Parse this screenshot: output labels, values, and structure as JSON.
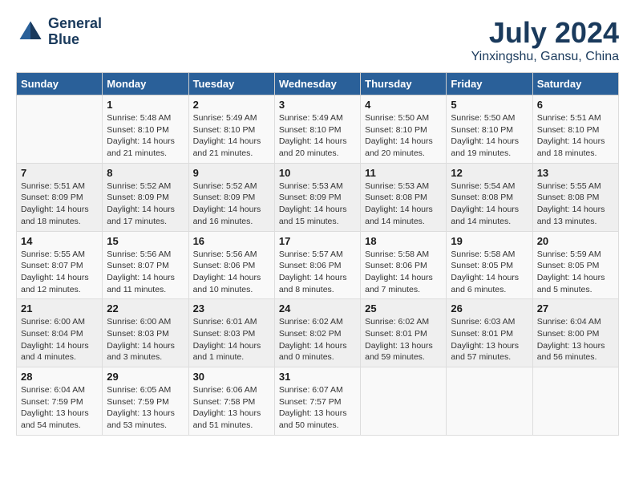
{
  "header": {
    "logo_line1": "General",
    "logo_line2": "Blue",
    "month": "July 2024",
    "location": "Yinxingshu, Gansu, China"
  },
  "weekdays": [
    "Sunday",
    "Monday",
    "Tuesday",
    "Wednesday",
    "Thursday",
    "Friday",
    "Saturday"
  ],
  "weeks": [
    [
      {
        "day": "",
        "info": ""
      },
      {
        "day": "1",
        "info": "Sunrise: 5:48 AM\nSunset: 8:10 PM\nDaylight: 14 hours\nand 21 minutes."
      },
      {
        "day": "2",
        "info": "Sunrise: 5:49 AM\nSunset: 8:10 PM\nDaylight: 14 hours\nand 21 minutes."
      },
      {
        "day": "3",
        "info": "Sunrise: 5:49 AM\nSunset: 8:10 PM\nDaylight: 14 hours\nand 20 minutes."
      },
      {
        "day": "4",
        "info": "Sunrise: 5:50 AM\nSunset: 8:10 PM\nDaylight: 14 hours\nand 20 minutes."
      },
      {
        "day": "5",
        "info": "Sunrise: 5:50 AM\nSunset: 8:10 PM\nDaylight: 14 hours\nand 19 minutes."
      },
      {
        "day": "6",
        "info": "Sunrise: 5:51 AM\nSunset: 8:10 PM\nDaylight: 14 hours\nand 18 minutes."
      }
    ],
    [
      {
        "day": "7",
        "info": "Sunrise: 5:51 AM\nSunset: 8:09 PM\nDaylight: 14 hours\nand 18 minutes."
      },
      {
        "day": "8",
        "info": "Sunrise: 5:52 AM\nSunset: 8:09 PM\nDaylight: 14 hours\nand 17 minutes."
      },
      {
        "day": "9",
        "info": "Sunrise: 5:52 AM\nSunset: 8:09 PM\nDaylight: 14 hours\nand 16 minutes."
      },
      {
        "day": "10",
        "info": "Sunrise: 5:53 AM\nSunset: 8:09 PM\nDaylight: 14 hours\nand 15 minutes."
      },
      {
        "day": "11",
        "info": "Sunrise: 5:53 AM\nSunset: 8:08 PM\nDaylight: 14 hours\nand 14 minutes."
      },
      {
        "day": "12",
        "info": "Sunrise: 5:54 AM\nSunset: 8:08 PM\nDaylight: 14 hours\nand 14 minutes."
      },
      {
        "day": "13",
        "info": "Sunrise: 5:55 AM\nSunset: 8:08 PM\nDaylight: 14 hours\nand 13 minutes."
      }
    ],
    [
      {
        "day": "14",
        "info": "Sunrise: 5:55 AM\nSunset: 8:07 PM\nDaylight: 14 hours\nand 12 minutes."
      },
      {
        "day": "15",
        "info": "Sunrise: 5:56 AM\nSunset: 8:07 PM\nDaylight: 14 hours\nand 11 minutes."
      },
      {
        "day": "16",
        "info": "Sunrise: 5:56 AM\nSunset: 8:06 PM\nDaylight: 14 hours\nand 10 minutes."
      },
      {
        "day": "17",
        "info": "Sunrise: 5:57 AM\nSunset: 8:06 PM\nDaylight: 14 hours\nand 8 minutes."
      },
      {
        "day": "18",
        "info": "Sunrise: 5:58 AM\nSunset: 8:06 PM\nDaylight: 14 hours\nand 7 minutes."
      },
      {
        "day": "19",
        "info": "Sunrise: 5:58 AM\nSunset: 8:05 PM\nDaylight: 14 hours\nand 6 minutes."
      },
      {
        "day": "20",
        "info": "Sunrise: 5:59 AM\nSunset: 8:05 PM\nDaylight: 14 hours\nand 5 minutes."
      }
    ],
    [
      {
        "day": "21",
        "info": "Sunrise: 6:00 AM\nSunset: 8:04 PM\nDaylight: 14 hours\nand 4 minutes."
      },
      {
        "day": "22",
        "info": "Sunrise: 6:00 AM\nSunset: 8:03 PM\nDaylight: 14 hours\nand 3 minutes."
      },
      {
        "day": "23",
        "info": "Sunrise: 6:01 AM\nSunset: 8:03 PM\nDaylight: 14 hours\nand 1 minute."
      },
      {
        "day": "24",
        "info": "Sunrise: 6:02 AM\nSunset: 8:02 PM\nDaylight: 14 hours\nand 0 minutes."
      },
      {
        "day": "25",
        "info": "Sunrise: 6:02 AM\nSunset: 8:01 PM\nDaylight: 13 hours\nand 59 minutes."
      },
      {
        "day": "26",
        "info": "Sunrise: 6:03 AM\nSunset: 8:01 PM\nDaylight: 13 hours\nand 57 minutes."
      },
      {
        "day": "27",
        "info": "Sunrise: 6:04 AM\nSunset: 8:00 PM\nDaylight: 13 hours\nand 56 minutes."
      }
    ],
    [
      {
        "day": "28",
        "info": "Sunrise: 6:04 AM\nSunset: 7:59 PM\nDaylight: 13 hours\nand 54 minutes."
      },
      {
        "day": "29",
        "info": "Sunrise: 6:05 AM\nSunset: 7:59 PM\nDaylight: 13 hours\nand 53 minutes."
      },
      {
        "day": "30",
        "info": "Sunrise: 6:06 AM\nSunset: 7:58 PM\nDaylight: 13 hours\nand 51 minutes."
      },
      {
        "day": "31",
        "info": "Sunrise: 6:07 AM\nSunset: 7:57 PM\nDaylight: 13 hours\nand 50 minutes."
      },
      {
        "day": "",
        "info": ""
      },
      {
        "day": "",
        "info": ""
      },
      {
        "day": "",
        "info": ""
      }
    ]
  ]
}
